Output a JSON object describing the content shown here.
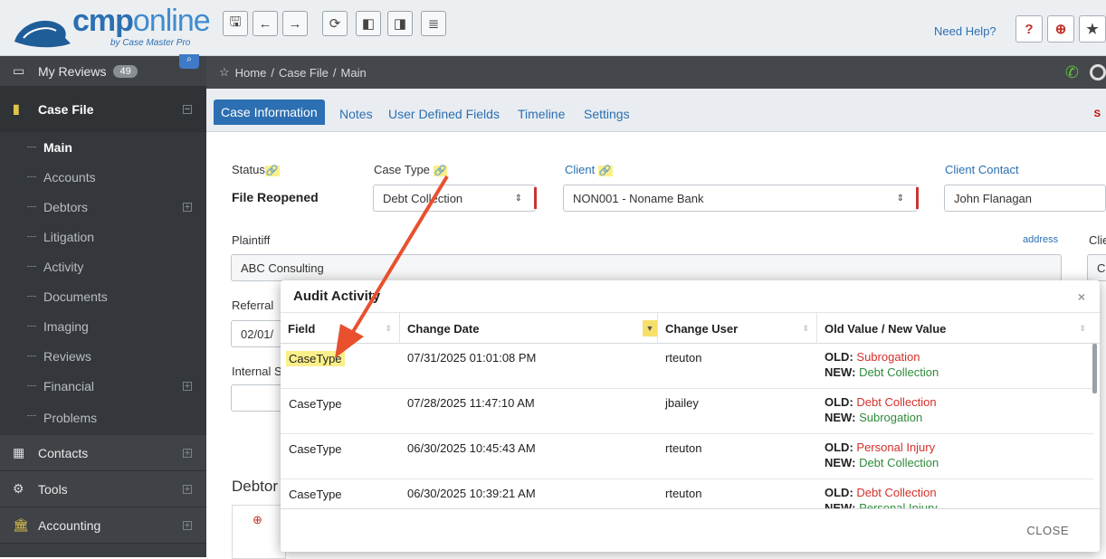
{
  "logo": {
    "brand_a": "cmp",
    "brand_b": "online",
    "tagline": "by Case Master Pro"
  },
  "toolbar": {
    "buttons": [
      "save-icon",
      "back-arrow-icon",
      "forward-arrow-icon",
      "refresh-icon",
      "prev-icon",
      "next-icon",
      "stack-icon"
    ],
    "need_help": "Need Help?"
  },
  "sidebar": {
    "my_reviews": "My Reviews",
    "my_reviews_count": "49",
    "case_file": "Case File",
    "items": [
      "Main",
      "Accounts",
      "Debtors",
      "Litigation",
      "Activity",
      "Documents",
      "Imaging",
      "Reviews",
      "Financial",
      "Problems"
    ],
    "contacts": "Contacts",
    "tools": "Tools",
    "accounting": "Accounting"
  },
  "breadcrumb": {
    "home": "Home",
    "sep": "/",
    "case_file": "Case File",
    "main": "Main"
  },
  "tabs": {
    "case_information": "Case Information",
    "notes": "Notes",
    "user_defined": "User Defined Fields",
    "timeline": "Timeline",
    "settings": "Settings",
    "right_flag": "S"
  },
  "form": {
    "status_label": "Status",
    "status_value": "File Reopened",
    "case_type_label": "Case Type",
    "case_type_value": "Debt Collection",
    "client_label": "Client",
    "client_value": "NON001 - Noname Bank",
    "client_contact_label": "Client Contact",
    "client_contact_value": "John Flanagan",
    "plaintiff_label": "Plaintiff",
    "plaintiff_value": "ABC Consulting",
    "address_link": "address",
    "cli_label": "Clie",
    "cli_value": "C",
    "referral_label": "Referral",
    "referral_value": "02/01/",
    "internal_label": "Internal S",
    "debtor_label": "Debtor"
  },
  "modal": {
    "title": "Audit Activity",
    "close_x": "×",
    "columns": [
      "Field",
      "Change Date",
      "Change User",
      "Old Value / New Value"
    ],
    "old_prefix": "OLD:",
    "new_prefix": "NEW:",
    "rows": [
      {
        "field": "CaseType",
        "date": "07/31/2025 01:01:08 PM",
        "user": "rteuton",
        "old": "Subrogation",
        "new": "Debt Collection"
      },
      {
        "field": "CaseType",
        "date": "07/28/2025 11:47:10 AM",
        "user": "jbailey",
        "old": "Debt Collection",
        "new": "Subrogation"
      },
      {
        "field": "CaseType",
        "date": "06/30/2025 10:45:43 AM",
        "user": "rteuton",
        "old": "Personal Injury",
        "new": "Debt Collection"
      },
      {
        "field": "CaseType",
        "date": "06/30/2025 10:39:21 AM",
        "user": "rteuton",
        "old": "Debt Collection",
        "new": "Personal Injury"
      }
    ],
    "close_button": "CLOSE"
  },
  "colors": {
    "accent": "#2c6fb2",
    "highlight": "#fbef8a",
    "arrow": "#e8502e",
    "old": "#d3302a",
    "new": "#2e8b3a"
  }
}
